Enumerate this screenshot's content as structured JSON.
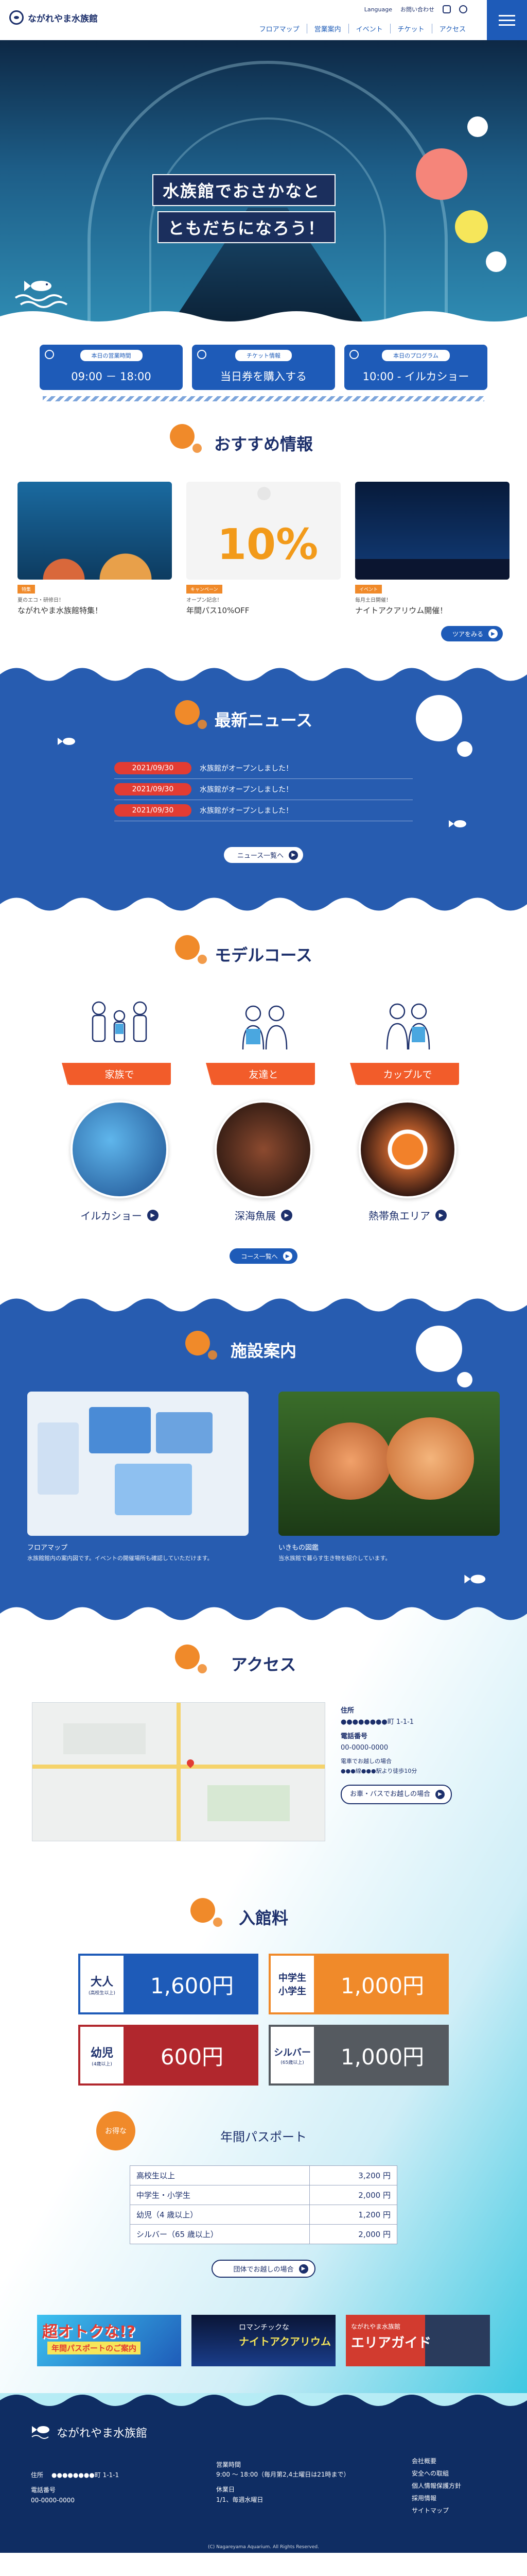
{
  "header": {
    "logo_text": "ながれやま水族館",
    "util": {
      "language": "Language",
      "contact": "お問い合わせ"
    },
    "nav": [
      "フロアマップ",
      "営業案内",
      "イベント",
      "チケット",
      "アクセス"
    ]
  },
  "hero": {
    "line1": "水族館でおさかなと",
    "line2": "ともだちになろう！"
  },
  "infobar": [
    {
      "label": "本日の営業時間",
      "value": "09:00 － 18:00"
    },
    {
      "label": "チケット情報",
      "value": "当日券を購入する"
    },
    {
      "label": "本日のプログラム",
      "value": "10:00 - イルカショー"
    }
  ],
  "recommend": {
    "title": "おすすめ情報",
    "items": [
      {
        "tag": "特集",
        "date": "夏のエコ・研修日！",
        "text": "ながれやま水族館特集！"
      },
      {
        "tag": "キャンペーン",
        "date": "オープン記念！",
        "text": "年間パス10%OFF"
      },
      {
        "tag": "イベント",
        "date": "毎月土日開催！",
        "text": "ナイトアクアリウム開催！"
      }
    ],
    "more": "ツアをみる"
  },
  "news": {
    "title": "最新ニュース",
    "items": [
      {
        "date": "2021/09/30",
        "text": "水族館がオープンしました！"
      },
      {
        "date": "2021/09/30",
        "text": "水族館がオープンしました！"
      },
      {
        "date": "2021/09/30",
        "text": "水族館がオープンしました！"
      }
    ],
    "more": "ニュース一覧へ"
  },
  "course": {
    "title": "モデルコース",
    "items": [
      {
        "who": "家族で",
        "name": "イルカショー"
      },
      {
        "who": "友達と",
        "name": "深海魚展"
      },
      {
        "who": "カップルで",
        "name": "熱帯魚エリア"
      }
    ],
    "more": "コース一覧へ"
  },
  "facility": {
    "title": "施設案内",
    "items": [
      {
        "title": "フロアマップ",
        "desc": "水族館館内の案内図です。イベントの開催場所も確認していただけます。"
      },
      {
        "title": "いきもの図鑑",
        "desc": "当水族館で暮らす生き物を紹介しています。"
      }
    ]
  },
  "access": {
    "title": "アクセス",
    "address_label": "住所",
    "address": "●●●●●●●●町 1-1-1",
    "tel_label": "電話番号",
    "tel": "00-0000-0000",
    "note": "電車でお越しの場合\n●●●線●●●駅より徒歩10分",
    "button": "お車・バスでお越しの場合"
  },
  "fees": {
    "title": "入館料",
    "tickets": [
      {
        "who": "大人",
        "sub": "(高校生以上)",
        "price": "1,600円",
        "color": "#1e5bb8"
      },
      {
        "who": "中学生\n小学生",
        "sub": "",
        "price": "1,000円",
        "color": "#f08a2a"
      },
      {
        "who": "幼児",
        "sub": "(4歳以上)",
        "price": "600円",
        "color": "#b1272d"
      },
      {
        "who": "シルバー",
        "sub": "(65歳以上)",
        "price": "1,000円",
        "color": "#555a60"
      }
    ],
    "pass_badge": "お得な",
    "pass_title": "年間パスポート",
    "pass_rows": [
      {
        "who": "高校生以上",
        "price": "3,200 円"
      },
      {
        "who": "中学生・小学生",
        "price": "2,000 円"
      },
      {
        "who": "幼児（4 歳以上）",
        "price": "1,200 円"
      },
      {
        "who": "シルバー（65 歳以上）",
        "price": "2,000 円"
      }
    ],
    "group_button": "団体でお越しの場合"
  },
  "banners": [
    {
      "main": "超オトクな!?",
      "sub": "年間パスポートのご案内"
    },
    {
      "main": "ロマンチックな",
      "sub": "ナイトアクアリウム"
    },
    {
      "main": "ながれやま水族館",
      "sub": "エリアガイド"
    }
  ],
  "footer": {
    "logo_text": "ながれやま水族館",
    "address_label": "住所",
    "address": "●●●●●●●●町 1-1-1",
    "tel_label": "電話番号",
    "tel": "00-0000-0000",
    "hours_label": "営業時間",
    "hours": "9:00 ～ 18:00（毎月第2,4土曜日は21時まで）",
    "closed_label": "休業日",
    "closed": "1/1、毎週水曜日",
    "links": [
      "会社概要",
      "安全への取組",
      "個人情報保護方針",
      "採用情報",
      "サイトマップ"
    ],
    "copyright": "(C) Nagareyama Aquarium. All Rights Reserved."
  }
}
